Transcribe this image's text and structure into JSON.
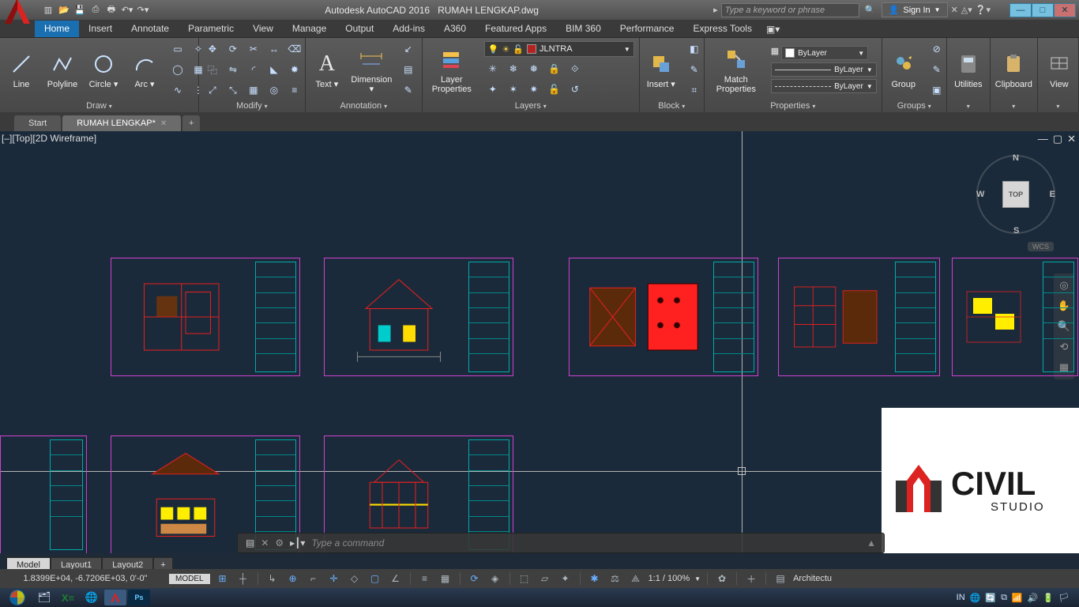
{
  "title": {
    "app": "Autodesk AutoCAD 2016",
    "file": "RUMAH LENGKAP.dwg"
  },
  "search_placeholder": "Type a keyword or phrase",
  "signin": "Sign In",
  "ribbon_tabs": [
    "Home",
    "Insert",
    "Annotate",
    "Parametric",
    "View",
    "Manage",
    "Output",
    "Add-ins",
    "A360",
    "Featured Apps",
    "BIM 360",
    "Performance",
    "Express Tools"
  ],
  "ribbon": {
    "draw": {
      "title": "Draw",
      "items": [
        "Line",
        "Polyline",
        "Circle",
        "Arc"
      ]
    },
    "modify": {
      "title": "Modify"
    },
    "annotation": {
      "title": "Annotation",
      "items": [
        "Text",
        "Dimension"
      ]
    },
    "layers": {
      "title": "Layers",
      "big": "Layer Properties",
      "current": "JLNTRA"
    },
    "block": {
      "title": "Block",
      "big": "Insert"
    },
    "properties": {
      "title": "Properties",
      "big": "Match Properties",
      "color": "ByLayer",
      "lw": "ByLayer",
      "lt": "ByLayer"
    },
    "groups": {
      "title": "Groups",
      "big": "Group"
    },
    "utilities": "Utilities",
    "clipboard": "Clipboard",
    "view": "View"
  },
  "doc_tabs": {
    "start": "Start",
    "active": "RUMAH LENGKAP*",
    "add": "+"
  },
  "viewport": {
    "label": "[–][Top][2D Wireframe]",
    "cube": "TOP",
    "wcs": "WCS"
  },
  "command": {
    "placeholder": "Type a command"
  },
  "layout_tabs": [
    "Model",
    "Layout1",
    "Layout2",
    "+"
  ],
  "status": {
    "coords": "1.8399E+04, -6.7206E+03, 0'-0\"",
    "mode": "MODEL",
    "scale": "1:1 / 100%",
    "ws": "Architectu",
    "lang": "IN"
  },
  "logo": {
    "brand": "CIVIL",
    "sub": "STUDIO"
  }
}
